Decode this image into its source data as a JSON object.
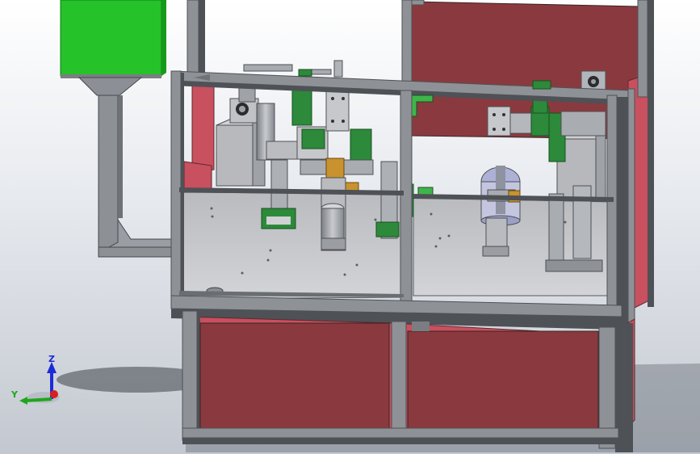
{
  "viewport": {
    "background_top": "#ffffff",
    "background_bottom": "#c3c8d0"
  },
  "model": {
    "colors": {
      "frame": "#8e9196",
      "frame_dark": "#4e5156",
      "panel_red": "#8a3a3e",
      "panel_red_light": "#c9505e",
      "plate": "#c2c4c8",
      "green_box": "#25c22a",
      "fixture_green": "#2c8a3a",
      "brass": "#c8922e"
    }
  },
  "triad": {
    "z_label": "Z",
    "y_label": "Y",
    "z_color": "#1b2bd8",
    "y_color": "#1fa61f",
    "x_color": "#d82020"
  }
}
